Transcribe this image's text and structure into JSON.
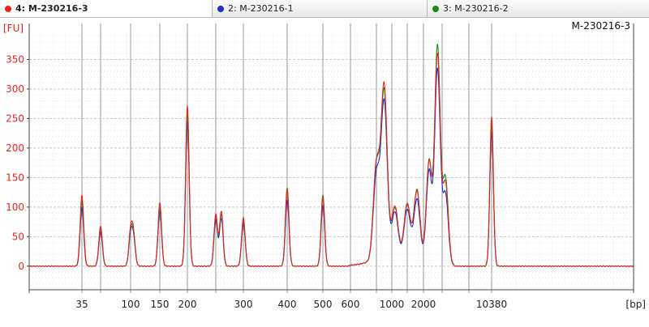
{
  "tabs": [
    {
      "label": "4: M-230216-3",
      "color": "#e8241c",
      "active": true
    },
    {
      "label": "2: M-230216-1",
      "color": "#1f2bd6",
      "active": false
    },
    {
      "label": "3: M-230216-2",
      "color": "#1a8a1a",
      "active": false
    }
  ],
  "chart_data": {
    "type": "line",
    "title": "M-230216-3",
    "ylabel": "[FU]",
    "xlabel": "[bp]",
    "y_ticks": [
      0,
      50,
      100,
      150,
      200,
      250,
      300,
      350
    ],
    "ylim": [
      -40,
      400
    ],
    "x_tick_labels": [
      "35",
      "100",
      "150",
      "200",
      "300",
      "400",
      "500",
      "600",
      "1000",
      "2000",
      "10380"
    ],
    "ladder_peaks_bp": [
      35,
      50,
      100,
      150,
      200,
      250,
      300,
      400,
      500,
      600,
      700,
      1000,
      1500,
      2000,
      3000,
      7000,
      10380
    ],
    "grid": true,
    "series": [
      {
        "name": "4: M-230216-3",
        "color": "#e8241c",
        "peaks": [
          [
            35,
            120
          ],
          [
            50,
            68
          ],
          [
            100,
            57
          ],
          [
            105,
            50
          ],
          [
            150,
            107
          ],
          [
            200,
            272
          ],
          [
            250,
            88
          ],
          [
            260,
            93
          ],
          [
            300,
            82
          ],
          [
            400,
            130
          ],
          [
            500,
            118
          ],
          [
            700,
            160
          ],
          [
            850,
            290
          ],
          [
            1100,
            84
          ],
          [
            1500,
            90
          ],
          [
            1800,
            115
          ],
          [
            2300,
            170
          ],
          [
            2750,
            355
          ],
          [
            3500,
            138
          ],
          [
            10380,
            253
          ]
        ]
      },
      {
        "name": "2: M-230216-1",
        "color": "#1f2bd6",
        "peaks": [
          [
            35,
            98
          ],
          [
            50,
            58
          ],
          [
            100,
            50
          ],
          [
            105,
            44
          ],
          [
            150,
            93
          ],
          [
            200,
            244
          ],
          [
            250,
            78
          ],
          [
            260,
            81
          ],
          [
            300,
            72
          ],
          [
            400,
            112
          ],
          [
            500,
            103
          ],
          [
            700,
            143
          ],
          [
            850,
            262
          ],
          [
            1100,
            74
          ],
          [
            1500,
            80
          ],
          [
            1800,
            102
          ],
          [
            2300,
            155
          ],
          [
            2750,
            330
          ],
          [
            3500,
            120
          ],
          [
            10380,
            228
          ]
        ]
      },
      {
        "name": "3: M-230216-2",
        "color": "#1a8a1a",
        "peaks": [
          [
            35,
            110
          ],
          [
            50,
            64
          ],
          [
            100,
            53
          ],
          [
            105,
            47
          ],
          [
            150,
            100
          ],
          [
            200,
            258
          ],
          [
            250,
            84
          ],
          [
            260,
            88
          ],
          [
            300,
            78
          ],
          [
            400,
            133
          ],
          [
            500,
            121
          ],
          [
            700,
            158
          ],
          [
            850,
            280
          ],
          [
            1100,
            81
          ],
          [
            1500,
            88
          ],
          [
            1800,
            118
          ],
          [
            2300,
            172
          ],
          [
            2750,
            370
          ],
          [
            3500,
            147
          ],
          [
            10380,
            238
          ]
        ]
      }
    ]
  }
}
